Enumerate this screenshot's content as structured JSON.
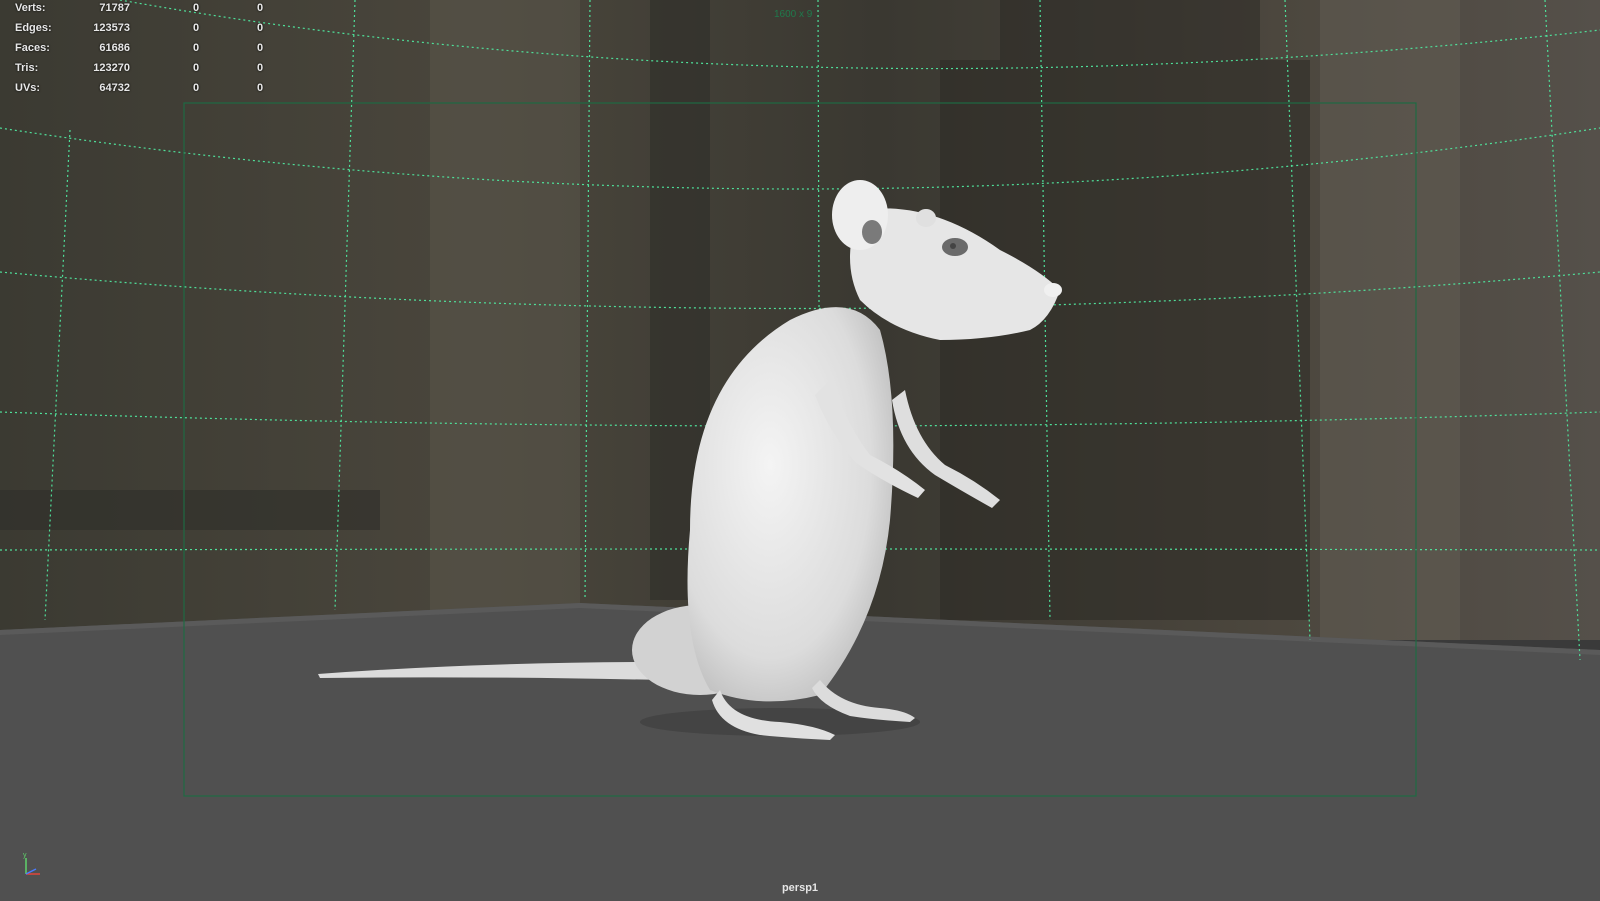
{
  "hud": {
    "rows": [
      {
        "label": "Verts:",
        "total": "71787",
        "selected": "0",
        "component": "0"
      },
      {
        "label": "Edges:",
        "total": "123573",
        "selected": "0",
        "component": "0"
      },
      {
        "label": "Faces:",
        "total": "61686",
        "selected": "0",
        "component": "0"
      },
      {
        "label": "Tris:",
        "total": "123270",
        "selected": "0",
        "component": "0"
      },
      {
        "label": "UVs:",
        "total": "64732",
        "selected": "0",
        "component": "0"
      }
    ]
  },
  "viewport": {
    "resolution_label": "1600 x 9",
    "camera_name": "persp1"
  },
  "axis_gizmo": {
    "y_label": "y",
    "colors": {
      "x": "#e0453a",
      "y": "#5fd36a",
      "z": "#4a7bff"
    }
  },
  "colors": {
    "grid": "#4fe09a",
    "resolution_gate": "#1e6a43",
    "floor": "#505050",
    "model": "#e9e9e9"
  }
}
